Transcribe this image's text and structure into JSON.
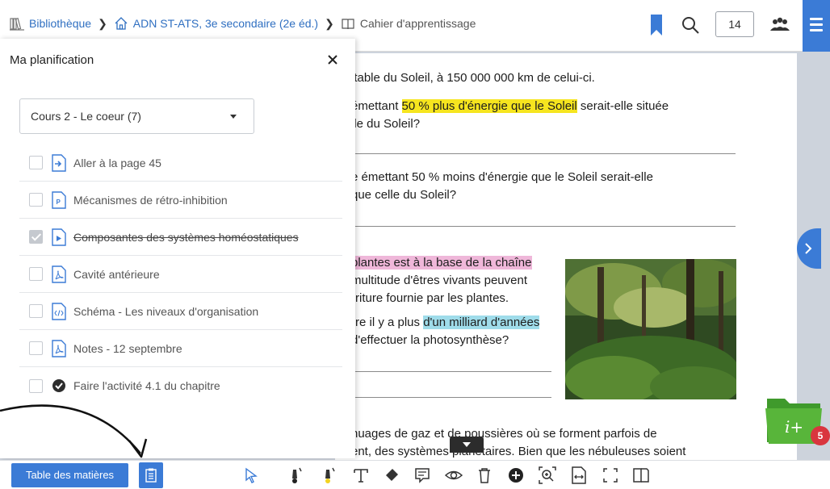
{
  "breadcrumb": {
    "items": [
      {
        "label": "Bibliothèque",
        "icon": "library-icon"
      },
      {
        "label": "ADN ST-ATS, 3e secondaire (2e éd.)",
        "icon": "home-icon"
      },
      {
        "label": "Cahier d'apprentissage",
        "icon": "book-icon"
      }
    ]
  },
  "header": {
    "page_number": "14"
  },
  "panel": {
    "title": "Ma planification",
    "select_value": "Cours 2 - Le coeur (7)",
    "items": [
      {
        "label": "Aller à la page 45",
        "icon": "goto-page-icon",
        "checked": false
      },
      {
        "label": "Mécanismes de rétro-inhibition",
        "icon": "presentation-file-icon",
        "checked": false
      },
      {
        "label": "Composantes des systèmes homéostatiques",
        "icon": "video-file-icon",
        "checked": true
      },
      {
        "label": "Cavité antérieure",
        "icon": "pdf-file-icon",
        "checked": false
      },
      {
        "label": "Schéma - Les niveaux d'organisation",
        "icon": "code-file-icon",
        "checked": false
      },
      {
        "label": "Notes - 12 septembre",
        "icon": "pdf-file-icon",
        "checked": false
      },
      {
        "label": "Faire l'activité 4.1 du chapitre",
        "icon": "check-circle-icon",
        "checked": false
      }
    ]
  },
  "page": {
    "l1": "itable du Soleil, à 150 000 000 km de celui-ci.",
    "l2a": "émettant ",
    "l2h": "50 % plus d'énergie que le Soleil",
    "l2b": " serait-elle située",
    "l3": "lle du Soleil?",
    "l4": "e émettant 50 % moins d'énergie que le Soleil serait-elle",
    "l5": " que celle du Soleil?",
    "l6h": " plantes est à la base de la chaîne",
    "l7": "multitude d'êtres vivants peuvent",
    "l8": "rriture fournie par les plantes.",
    "l9a": "rre il y a plus ",
    "l9h": "d'un milliard d'années",
    "l10": "d'effectuer la photosynthèse?",
    "l11": "nuages de gaz et de poussières où se forment parfois de",
    "l12": "ent, des systèmes planétaires. Bien que les nébuleuses soient"
  },
  "toolbar": {
    "toc_label": "Table des matières",
    "tools": [
      "select-pointer-icon",
      "pen-icon",
      "highlighter-icon",
      "text-tool-icon",
      "eraser-icon",
      "note-icon",
      "eye-icon",
      "trash-icon",
      "add-circle-icon",
      "zoom-area-icon",
      "fit-width-icon",
      "fullscreen-icon",
      "dual-page-icon"
    ]
  },
  "folder": {
    "badge_count": "5",
    "label": "i+"
  },
  "colors": {
    "accent": "#3b7bd6",
    "highlight_yellow": "#f6e51f",
    "highlight_pink": "#efb7d9",
    "highlight_cyan": "#9fdcea",
    "folder_green": "#4caf35",
    "badge_red": "#d9353e"
  }
}
